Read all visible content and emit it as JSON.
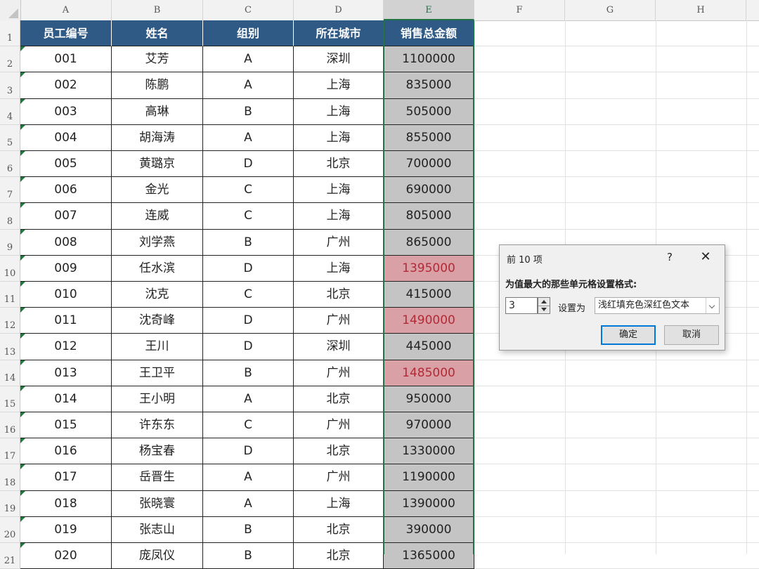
{
  "columns": [
    "A",
    "B",
    "C",
    "D",
    "E",
    "F",
    "G",
    "H"
  ],
  "header": [
    "员工编号",
    "姓名",
    "组别",
    "所在城市",
    "销售总金额"
  ],
  "rows": [
    {
      "row": "1",
      "cells": null
    },
    {
      "row": "2",
      "cells": [
        "001",
        "艾芳",
        "A",
        "深圳",
        "1100000"
      ],
      "hi": false
    },
    {
      "row": "3",
      "cells": [
        "002",
        "陈鹏",
        "A",
        "上海",
        "835000"
      ],
      "hi": false
    },
    {
      "row": "4",
      "cells": [
        "003",
        "高琳",
        "B",
        "上海",
        "505000"
      ],
      "hi": false
    },
    {
      "row": "5",
      "cells": [
        "004",
        "胡海涛",
        "A",
        "上海",
        "855000"
      ],
      "hi": false
    },
    {
      "row": "6",
      "cells": [
        "005",
        "黄璐京",
        "D",
        "北京",
        "700000"
      ],
      "hi": false
    },
    {
      "row": "7",
      "cells": [
        "006",
        "金光",
        "C",
        "上海",
        "690000"
      ],
      "hi": false
    },
    {
      "row": "8",
      "cells": [
        "007",
        "连威",
        "C",
        "上海",
        "805000"
      ],
      "hi": false
    },
    {
      "row": "9",
      "cells": [
        "008",
        "刘学燕",
        "B",
        "广州",
        "865000"
      ],
      "hi": false
    },
    {
      "row": "10",
      "cells": [
        "009",
        "任水滨",
        "D",
        "上海",
        "1395000"
      ],
      "hi": true
    },
    {
      "row": "11",
      "cells": [
        "010",
        "沈克",
        "C",
        "北京",
        "415000"
      ],
      "hi": false
    },
    {
      "row": "12",
      "cells": [
        "011",
        "沈奇峰",
        "D",
        "广州",
        "1490000"
      ],
      "hi": true
    },
    {
      "row": "13",
      "cells": [
        "012",
        "王川",
        "D",
        "深圳",
        "445000"
      ],
      "hi": false
    },
    {
      "row": "14",
      "cells": [
        "013",
        "王卫平",
        "B",
        "广州",
        "1485000"
      ],
      "hi": true
    },
    {
      "row": "15",
      "cells": [
        "014",
        "王小明",
        "A",
        "北京",
        "950000"
      ],
      "hi": false
    },
    {
      "row": "16",
      "cells": [
        "015",
        "许东东",
        "C",
        "广州",
        "970000"
      ],
      "hi": false
    },
    {
      "row": "17",
      "cells": [
        "016",
        "杨宝春",
        "D",
        "北京",
        "1330000"
      ],
      "hi": false
    },
    {
      "row": "18",
      "cells": [
        "017",
        "岳晋生",
        "A",
        "广州",
        "1190000"
      ],
      "hi": false
    },
    {
      "row": "19",
      "cells": [
        "018",
        "张晓寰",
        "A",
        "上海",
        "1390000"
      ],
      "hi": false
    },
    {
      "row": "20",
      "cells": [
        "019",
        "张志山",
        "B",
        "北京",
        "390000"
      ],
      "hi": false
    },
    {
      "row": "21",
      "cells": [
        "020",
        "庞凤仪",
        "B",
        "北京",
        "1365000"
      ],
      "hi": false
    }
  ],
  "colors": {
    "header_fill": "#2f5a86",
    "highlight_fill": "#d9a0a6",
    "highlight_text": "#b22a36",
    "selected_fill": "#c4c4c4",
    "accent": "#217346"
  },
  "dialog": {
    "title": "前 10 项",
    "help": "?",
    "close": "✕",
    "prompt": "为值最大的那些单元格设置格式:",
    "count": "3",
    "set_as": "设置为",
    "format": "浅红填充色深红色文本",
    "ok": "确定",
    "cancel": "取消"
  }
}
